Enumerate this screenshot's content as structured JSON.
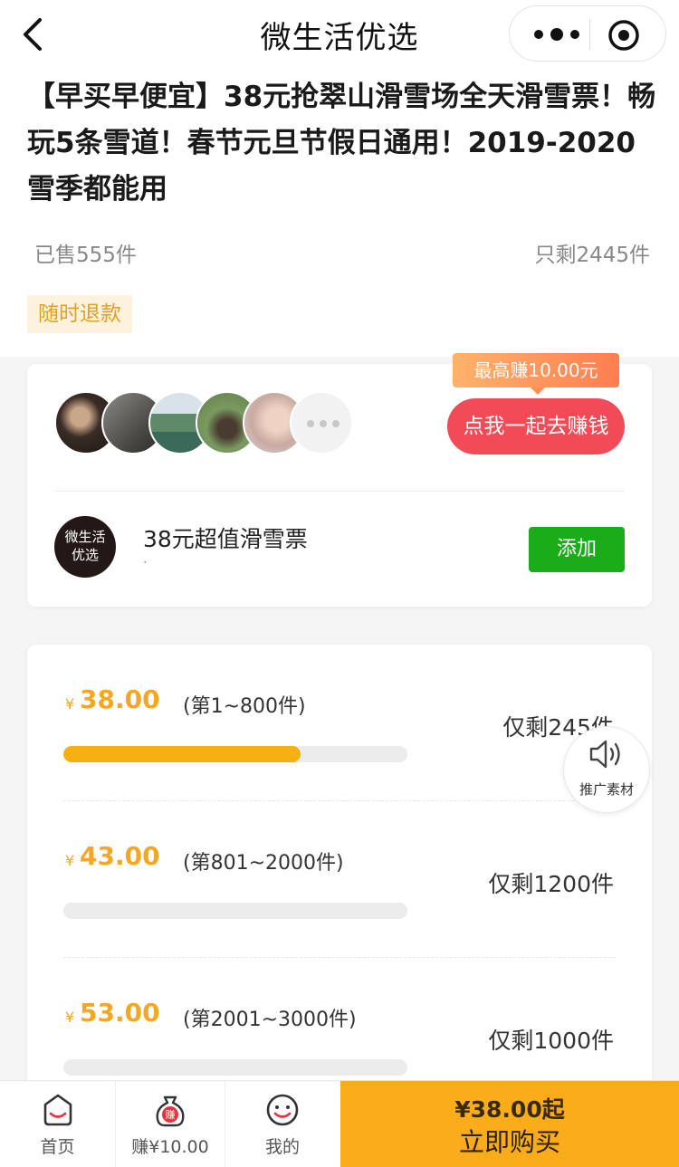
{
  "navbar": {
    "title": "微生活优选",
    "back_icon": "chevron-left-icon",
    "more_icon": "more-dots-icon",
    "close_icon": "target-circle-icon"
  },
  "product": {
    "title": "【早买早便宜】38元抢翠山滑雪场全天滑雪票！畅玩5条雪道！春节元旦节假日通用！2019-2020雪季都能用",
    "sold": "已售555件",
    "remaining": "只剩2445件",
    "tag": "随时退款"
  },
  "earn_card": {
    "max_earn": "最高赚10.00元",
    "earn_button": "点我一起去赚钱",
    "more_icon": "more-dots-icon",
    "brand_logo": "微生活\n优选",
    "brand_name": "38元超值滑雪票",
    "brand_sub": "·",
    "add_button": "添加"
  },
  "tiers": [
    {
      "currency": "¥",
      "price": "38.00",
      "range": "(第1~800件)",
      "left": "仅剩245件",
      "progress": 0.69
    },
    {
      "currency": "¥",
      "price": "43.00",
      "range": "(第801~2000件)",
      "left": "仅剩1200件",
      "progress": 0
    },
    {
      "currency": "¥",
      "price": "53.00",
      "range": "(第2001~3000件)",
      "left": "仅剩1000件",
      "progress": 0
    }
  ],
  "promo_float": {
    "icon": "speaker-icon",
    "label": "推广素材"
  },
  "tabbar": {
    "home": {
      "label": "首页",
      "icon": "home-icon"
    },
    "earn": {
      "label": "赚¥10.00",
      "icon": "money-bag-icon",
      "icon_text": "赚"
    },
    "mine": {
      "label": "我的",
      "icon": "smiley-user-icon"
    },
    "buy": {
      "price": "¥38.00起",
      "label": "立即购买"
    }
  },
  "colors": {
    "accent": "#f5a623",
    "buy": "#fbac1a",
    "earn_red": "#f24b57",
    "add_green": "#1aad19"
  }
}
